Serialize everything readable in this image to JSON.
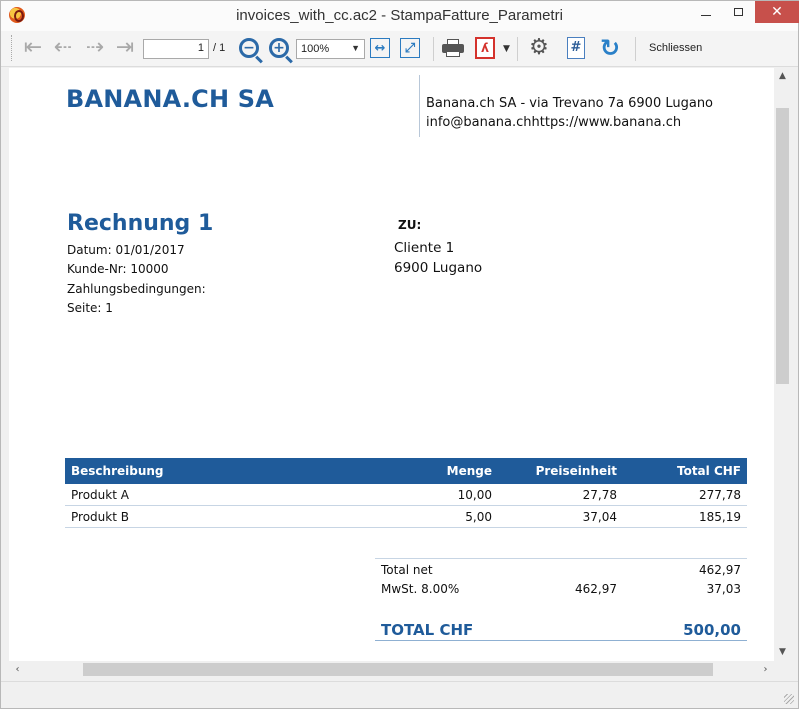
{
  "window": {
    "title": "invoices_with_cc.ac2 - StampaFatture_Parametri",
    "close_symbol": "✕"
  },
  "toolbar": {
    "first_page_icon": "first-page-icon",
    "page_value": "1",
    "page_total": "/ 1",
    "zoom_value": "100%",
    "close_label": "Schliessen"
  },
  "document": {
    "company_name": "BANANA.CH SA",
    "company_address_line1": "Banana.ch SA - via Trevano 7a 6900 Lugano",
    "company_address_line2": "info@banana.chhttps://www.banana.ch",
    "invoice_title": "Rechnung 1",
    "invoice_date": "Datum: 01/01/2017",
    "customer_number": "Kunde-Nr: 10000",
    "payment_terms": "Zahlungsbedingungen:",
    "page": "Seite: 1",
    "to_label": "ZU:",
    "customer_name": "Cliente 1",
    "customer_city": "6900 Lugano",
    "table": {
      "headers": [
        "Beschreibung",
        "Menge",
        "Preiseinheit",
        "Total CHF"
      ],
      "rows": [
        [
          "Produkt A",
          "10,00",
          "27,78",
          "277,78"
        ],
        [
          "Produkt B",
          "5,00",
          "37,04",
          "185,19"
        ]
      ]
    },
    "summary": {
      "total_net_label": "Total net",
      "total_net_value": "462,97",
      "vat_label": "MwSt. 8.00%",
      "vat_base": "462,97",
      "vat_value": "37,03",
      "grand_label": "TOTAL CHF",
      "grand_value": "500,00"
    }
  },
  "colors": {
    "brand_blue": "#1f5b9a",
    "close_button_red": "#c7504b"
  }
}
